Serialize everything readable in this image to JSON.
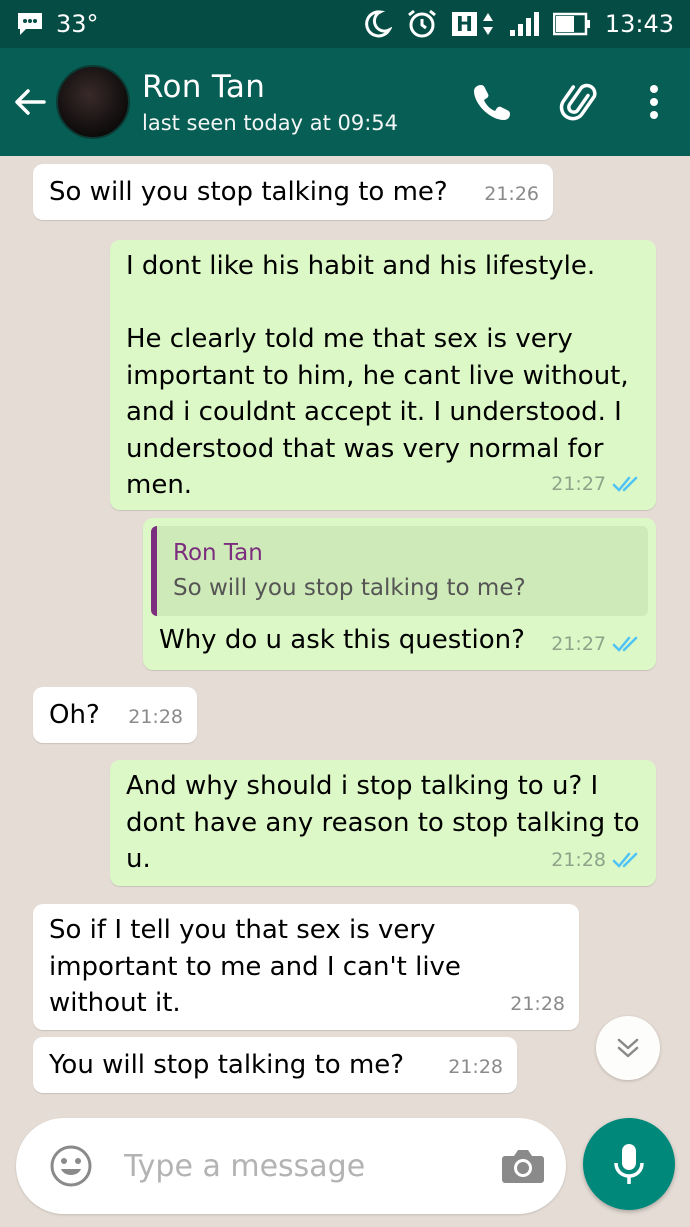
{
  "status_bar": {
    "temperature": "33°",
    "network": "H",
    "time": "13:43"
  },
  "header": {
    "contact_name": "Ron Tan",
    "last_seen": "last seen today at 09:54"
  },
  "messages": [
    {
      "direction": "in",
      "text": "So will you stop talking to me?",
      "time": "21:26"
    },
    {
      "direction": "out",
      "text": "I dont like his habit and his lifestyle.\n\nHe clearly told me that sex is very important to him, he cant live without, and i couldnt accept it. I understood. I understood that was very normal for men.",
      "time": "21:27",
      "ticks": "read"
    },
    {
      "direction": "out",
      "quote_name": "Ron Tan",
      "quote_text": "So will you stop talking to me?",
      "text": "Why do u ask this question?",
      "time": "21:27",
      "ticks": "read"
    },
    {
      "direction": "in",
      "text": "Oh?",
      "time": "21:28"
    },
    {
      "direction": "out",
      "text": "And why should i stop talking to u? I dont have any reason to stop talking to u.",
      "time": "21:28",
      "ticks": "read"
    },
    {
      "direction": "in",
      "text": "So if I tell you that sex is very important to me and I can't live without it.",
      "time": "21:28"
    },
    {
      "direction": "in",
      "text": "You will stop talking to me?",
      "time": "21:28"
    }
  ],
  "composer": {
    "placeholder": "Type a message"
  },
  "colors": {
    "header": "#075e54",
    "status_bar": "#054d44",
    "outgoing_bubble": "#dcf8c6",
    "incoming_bubble": "#ffffff",
    "accent": "#00897b",
    "read_ticks": "#4fc3f7",
    "quote_accent": "#7b2d7e"
  }
}
